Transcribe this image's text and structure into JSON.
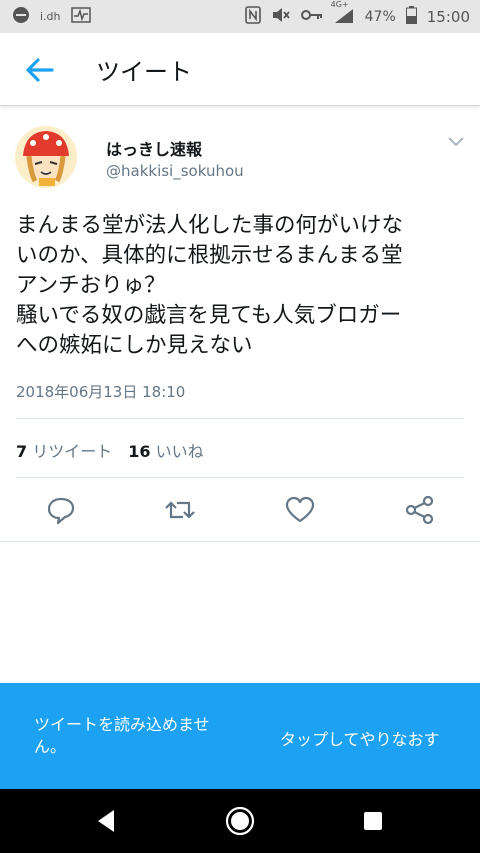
{
  "status_bar": {
    "carrier_text": "i.dh",
    "network": "4G+",
    "battery": "47%",
    "time": "15:00"
  },
  "app_bar": {
    "title": "ツイート",
    "back_icon": "arrow-left-icon"
  },
  "tweet": {
    "display_name": "はっきし速報",
    "handle": "@hakkisi_sokuhou",
    "text": "まんまる堂が法人化した事の何がいけな\nいのか、具体的に根拠示せるまんまる堂\nアンチおりゅ？\n騒いでる奴の戯言を見ても人気ブロガー\nへの嫉妬にしか見えない",
    "timestamp": "2018年06月13日 18:10",
    "retweet_count": "7",
    "retweet_label": "リツイート",
    "like_count": "16",
    "like_label": "いいね"
  },
  "actions": [
    "reply-icon",
    "retweet-icon",
    "like-icon",
    "share-icon"
  ],
  "snackbar": {
    "message": "ツイートを読み込めませ\nん。",
    "action": "タップしてやりなおす"
  },
  "colors": {
    "accent": "#1da1f2",
    "secondary_text": "#657786",
    "divider": "#e1e8ed"
  }
}
